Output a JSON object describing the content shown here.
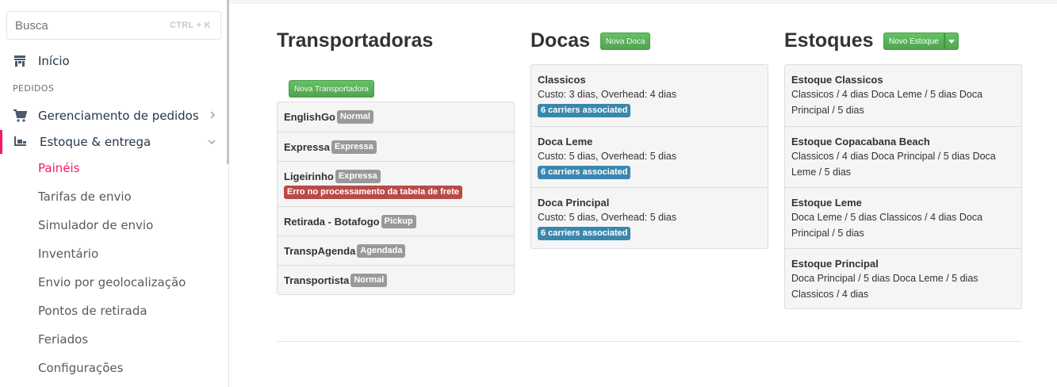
{
  "sidebar": {
    "search": {
      "placeholder": "Busca",
      "shortcut": "CTRL + K"
    },
    "home_label": "Início",
    "section_label": "PEDIDOS",
    "order_mgmt_label": "Gerenciamento de pedidos",
    "stock_label": "Estoque & entrega",
    "sub_items": [
      "Painéis",
      "Tarifas de envio",
      "Simulador de envio",
      "Inventário",
      "Envio por geolocalização",
      "Pontos de retirada",
      "Feriados",
      "Configurações"
    ],
    "active_sub_item": "Painéis"
  },
  "carriers": {
    "title": "Transportadoras",
    "new_button": "Nova Transportadora",
    "items": [
      {
        "name": "EnglishGo",
        "badge": "Normal"
      },
      {
        "name": "Expressa",
        "badge": "Expressa"
      },
      {
        "name": "Ligeirinho",
        "badge": "Expressa",
        "error": "Erro no processamento da tabela de frete"
      },
      {
        "name": "Retirada - Botafogo",
        "badge": "Pickup"
      },
      {
        "name": "TranspAgenda",
        "badge": "Agendada"
      },
      {
        "name": "Transportista",
        "badge": "Normal"
      }
    ]
  },
  "docks": {
    "title": "Docas",
    "new_button": "Nova Doca",
    "items": [
      {
        "name": "Classicos",
        "desc": "Custo: 3 dias, Overhead: 4 dias",
        "badge": "6 carriers associated"
      },
      {
        "name": "Doca Leme",
        "desc": "Custo: 5 dias, Overhead: 5 dias",
        "badge": "6 carriers associated"
      },
      {
        "name": "Doca Principal",
        "desc": "Custo: 5 dias, Overhead: 5 dias",
        "badge": "6 carriers associated"
      }
    ]
  },
  "stocks": {
    "title": "Estoques",
    "new_button": "Novo Estoque",
    "items": [
      {
        "name": "Estoque Classicos",
        "line1": "Classicos / 4 dias Doca Leme / 5 dias Doca",
        "line2": "Principal / 5 dias"
      },
      {
        "name": "Estoque Copacabana Beach",
        "line1": "Classicos / 4 dias Doca Principal / 5 dias Doca",
        "line2": "Leme / 5 dias"
      },
      {
        "name": "Estoque Leme",
        "line1": "Doca Leme / 5 dias Classicos / 4 dias Doca",
        "line2": "Principal / 5 dias"
      },
      {
        "name": "Estoque Principal",
        "line1": "Doca Principal / 5 dias Doca Leme / 5 dias",
        "line2": "Classicos / 4 dias"
      }
    ]
  },
  "colors": {
    "accent_pink": "#f71963",
    "success_green": "#51a351",
    "info_blue": "#3a87ad",
    "error_red": "#b94a48",
    "badge_gray": "#999999"
  }
}
